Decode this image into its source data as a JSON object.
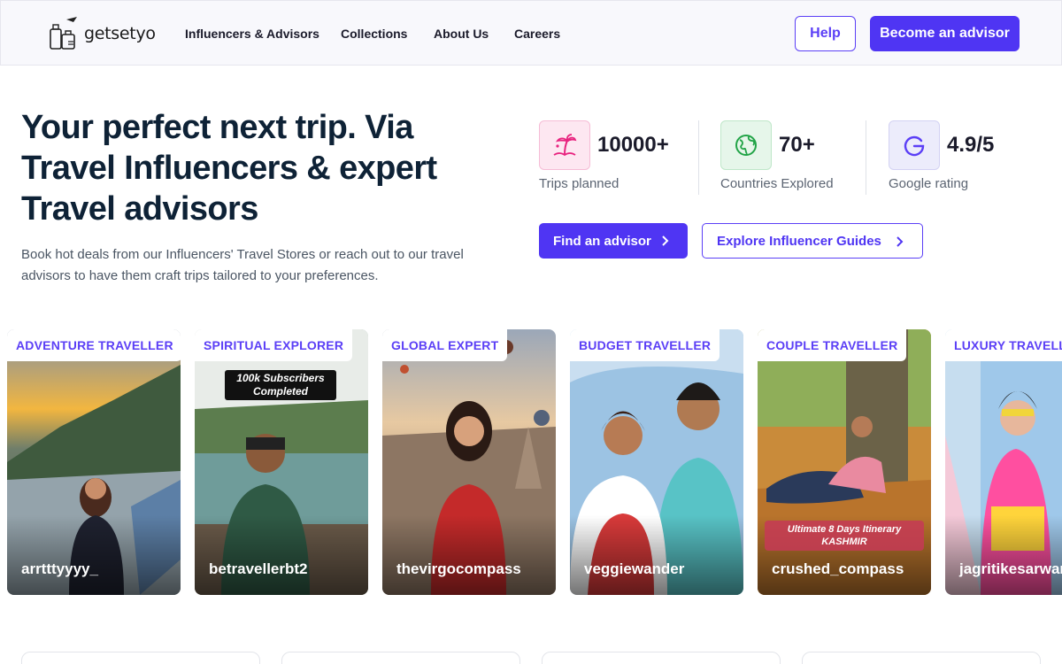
{
  "header": {
    "logo_text": "getsetyo",
    "nav": [
      "Influencers & Advisors",
      "Collections",
      "About Us",
      "Careers"
    ],
    "help_label": "Help",
    "become_label": "Become an advisor"
  },
  "hero": {
    "title": "Your perfect next trip. Via Travel Influencers & expert Travel advisors",
    "subtitle": "Book hot deals from our Influencers' Travel Stores or reach out to our travel advisors to have them craft trips tailored to your preferences."
  },
  "stats": [
    {
      "value": "10000+",
      "label": "Trips planned",
      "icon": "palm-tree-icon",
      "color": "#e8237f",
      "bg": "#fde7f1"
    },
    {
      "value": "70+",
      "label": "Countries Explored",
      "icon": "globe-icon",
      "color": "#22a447",
      "bg": "#e6f6ea"
    },
    {
      "value": "4.9/5",
      "label": "Google rating",
      "icon": "google-icon",
      "color": "#5b3ff6",
      "bg": "#ececfb"
    }
  ],
  "cta": {
    "find_label": "Find an advisor",
    "explore_label": "Explore Influencer Guides"
  },
  "cards": [
    {
      "tag": "ADVENTURE TRAVELLER",
      "name": "arrtttyyyy_"
    },
    {
      "tag": "SPIRITUAL EXPLORER",
      "name": "betravellerbt2",
      "overlay": "100k Subscribers Completed"
    },
    {
      "tag": "GLOBAL EXPERT",
      "name": "thevirgocompass"
    },
    {
      "tag": "BUDGET TRAVELLER",
      "name": "veggiewander"
    },
    {
      "tag": "COUPLE TRAVELLER",
      "name": "crushed_compass",
      "overlay": "Ultimate 8 Days Itinerary KASHMIR"
    },
    {
      "tag": "LUXURY TRAVELLER",
      "name": "jagritikesarwani"
    }
  ],
  "colors": {
    "accent": "#4f35f3",
    "heading": "#0e2236"
  }
}
